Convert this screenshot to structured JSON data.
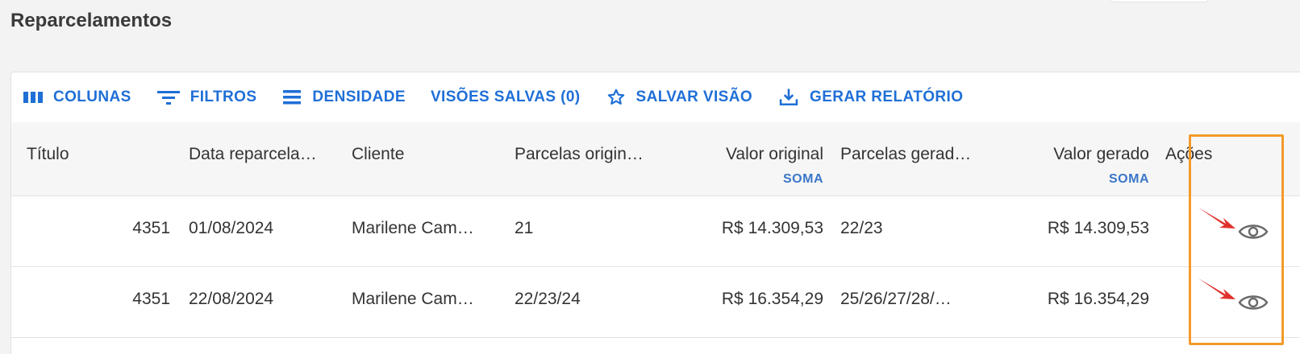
{
  "page": {
    "title": "Reparcelamentos"
  },
  "toolbar": {
    "columns_label": "COLUNAS",
    "filters_label": "FILTROS",
    "density_label": "DENSIDADE",
    "saved_views_label": "VISÕES SALVAS (0)",
    "save_view_label": "SALVAR VISÃO",
    "report_label": "GERAR RELATÓRIO"
  },
  "table": {
    "columns": {
      "titulo": "Título",
      "data": "Data reparcela…",
      "cliente": "Cliente",
      "parcelas_originais": "Parcelas origin…",
      "valor_original": "Valor original",
      "valor_original_agg": "SOMA",
      "parcelas_geradas": "Parcelas gerad…",
      "valor_gerado": "Valor gerado",
      "valor_gerado_agg": "SOMA",
      "acoes": "Ações"
    },
    "rows": [
      {
        "titulo": "4351",
        "data": "01/08/2024",
        "cliente": "Marilene Cam…",
        "parcelas_originais": "21",
        "valor_original": "R$ 14.309,53",
        "parcelas_geradas": "22/23",
        "valor_gerado": "R$ 14.309,53"
      },
      {
        "titulo": "4351",
        "data": "22/08/2024",
        "cliente": "Marilene Cam…",
        "parcelas_originais": "22/23/24",
        "valor_original": "R$ 16.354,29",
        "parcelas_geradas": "25/26/27/28/…",
        "valor_gerado": "R$ 16.354,29"
      }
    ]
  },
  "colors": {
    "accent": "#1f6fd6",
    "highlight": "#f39a2a",
    "arrow": "#e0312b"
  },
  "icons": [
    "columns-icon",
    "filter-icon",
    "density-icon",
    "star-icon",
    "download-icon",
    "eye-icon"
  ]
}
